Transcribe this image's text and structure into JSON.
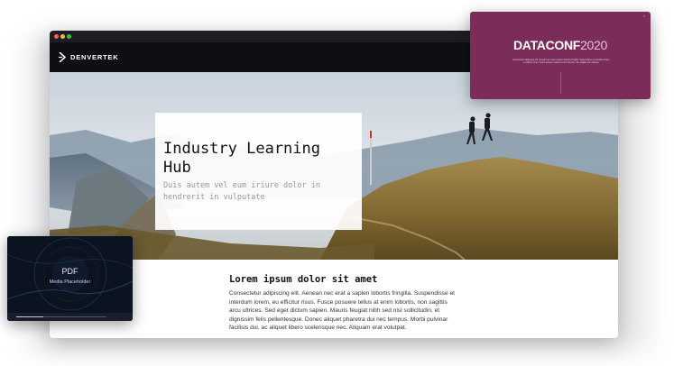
{
  "brand": {
    "name": "DENVERTEK"
  },
  "hero": {
    "title": "Industry Learning Hub",
    "subtitle": "Duis autem vel eum iriure dolor in hendrerit in vulputate"
  },
  "article": {
    "heading": "Lorem ipsum dolor sit amet",
    "body": "Consectetur adipiscing elit. Aenean nec erat a sapien lobortis fringilla. Suspendisse et interdum lorem, eu efficitur risus. Fusce posuere tellus at enim lobortis, non sagittis arcu ultrices. Sed eget dictum sapien. Mauris feugiat nibh sed nisl sollicitudin, et dignissim felis pellentesque. Donec aliquet pharetra dui nec tempus. Morbi pulvinar facilisis dui, ac aliquet libero scelerisque nec. Aliquam erat volutpat."
  },
  "conference": {
    "title_main": "DATACONF",
    "title_year": "2020",
    "description": "Consectetur adipiscing elit. Aenean nec erat a sapien lobortis fringilla. Suspendisse et interdum lorem, eu efficitur risus. Fusce posuere tellus at enim lobortis, non sagittis arcu ultrices."
  },
  "pdf": {
    "label": "PDF",
    "sublabel": "Media Placeholder",
    "progress": 0.3
  },
  "colors": {
    "accent": "#7b2c59",
    "header": "#0e0f12"
  }
}
